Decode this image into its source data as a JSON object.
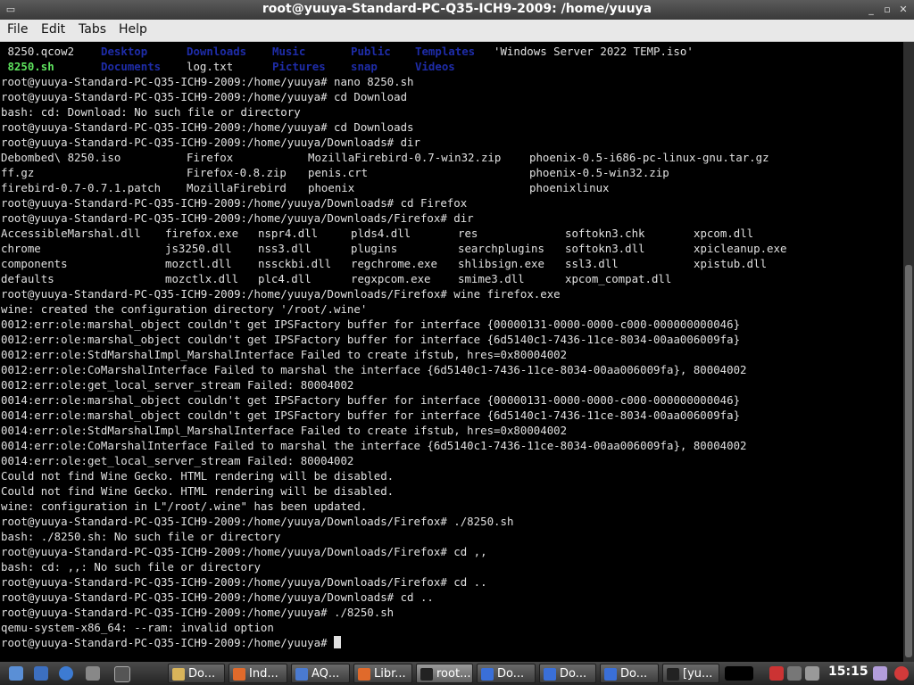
{
  "window": {
    "title": "root@yuuya-Standard-PC-Q35-ICH9-2009: /home/yuuya"
  },
  "menu": [
    "File",
    "Edit",
    "Tabs",
    "Help"
  ],
  "colors": {
    "dir": "#1e2ca8",
    "exe": "#5ee35e",
    "text": "#e0e0e0"
  },
  "terminal": {
    "lines": [
      [
        {
          "t": " 8250.qcow2",
          "c": 0
        },
        {
          "t": "Desktop",
          "c": 112,
          "k": "dir"
        },
        {
          "t": "Downloads",
          "c": 208,
          "k": "dir"
        },
        {
          "t": "Music",
          "c": 304,
          "k": "dir"
        },
        {
          "t": "Public",
          "c": 392,
          "k": "dir"
        },
        {
          "t": "Templates",
          "c": 464,
          "k": "dir"
        },
        {
          "t": "'Windows Server 2022 TEMP.iso'",
          "c": 552
        }
      ],
      [
        {
          "t": " 8250.sh",
          "c": 0,
          "k": "exe"
        },
        {
          "t": "Documents",
          "c": 112,
          "k": "dir"
        },
        {
          "t": "log.txt",
          "c": 208
        },
        {
          "t": "Pictures",
          "c": 304,
          "k": "dir"
        },
        {
          "t": "snap",
          "c": 392,
          "k": "dir"
        },
        {
          "t": "Videos",
          "c": 464,
          "k": "dir"
        }
      ],
      "root@yuuya-Standard-PC-Q35-ICH9-2009:/home/yuuya# nano 8250.sh",
      "root@yuuya-Standard-PC-Q35-ICH9-2009:/home/yuuya# cd Download",
      "bash: cd: Download: No such file or directory",
      "root@yuuya-Standard-PC-Q35-ICH9-2009:/home/yuuya# cd Downloads",
      "root@yuuya-Standard-PC-Q35-ICH9-2009:/home/yuuya/Downloads# dir",
      [
        {
          "t": "Debombed\\ 8250.iso",
          "c": 0
        },
        {
          "t": "Firefox",
          "c": 208
        },
        {
          "t": "MozillaFirebird-0.7-win32.zip",
          "c": 344
        },
        {
          "t": "phoenix-0.5-i686-pc-linux-gnu.tar.gz",
          "c": 592
        }
      ],
      [
        {
          "t": "ff.gz",
          "c": 0
        },
        {
          "t": "Firefox-0.8.zip",
          "c": 208
        },
        {
          "t": "penis.crt",
          "c": 344
        },
        {
          "t": "phoenix-0.5-win32.zip",
          "c": 592
        }
      ],
      [
        {
          "t": "firebird-0.7-0.7.1.patch",
          "c": 0
        },
        {
          "t": "MozillaFirebird",
          "c": 208
        },
        {
          "t": "phoenix",
          "c": 344
        },
        {
          "t": "phoenixlinux",
          "c": 592
        }
      ],
      "root@yuuya-Standard-PC-Q35-ICH9-2009:/home/yuuya/Downloads# cd Firefox",
      "root@yuuya-Standard-PC-Q35-ICH9-2009:/home/yuuya/Downloads/Firefox# dir",
      [
        {
          "t": "AccessibleMarshal.dll",
          "c": 0
        },
        {
          "t": "firefox.exe",
          "c": 184
        },
        {
          "t": "nspr4.dll",
          "c": 288
        },
        {
          "t": "plds4.dll",
          "c": 392
        },
        {
          "t": "res",
          "c": 512
        },
        {
          "t": "softokn3.chk",
          "c": 632
        },
        {
          "t": "xpcom.dll",
          "c": 776
        }
      ],
      [
        {
          "t": "chrome",
          "c": 0
        },
        {
          "t": "js3250.dll",
          "c": 184
        },
        {
          "t": "nss3.dll",
          "c": 288
        },
        {
          "t": "plugins",
          "c": 392
        },
        {
          "t": "searchplugins",
          "c": 512
        },
        {
          "t": "softokn3.dll",
          "c": 632
        },
        {
          "t": "xpicleanup.exe",
          "c": 776
        }
      ],
      [
        {
          "t": "components",
          "c": 0
        },
        {
          "t": "mozctl.dll",
          "c": 184
        },
        {
          "t": "nssckbi.dll",
          "c": 288
        },
        {
          "t": "regchrome.exe",
          "c": 392
        },
        {
          "t": "shlibsign.exe",
          "c": 512
        },
        {
          "t": "ssl3.dll",
          "c": 632
        },
        {
          "t": "xpistub.dll",
          "c": 776
        }
      ],
      [
        {
          "t": "defaults",
          "c": 0
        },
        {
          "t": "mozctlx.dll",
          "c": 184
        },
        {
          "t": "plc4.dll",
          "c": 288
        },
        {
          "t": "regxpcom.exe",
          "c": 392
        },
        {
          "t": "smime3.dll",
          "c": 512
        },
        {
          "t": "xpcom_compat.dll",
          "c": 632
        }
      ],
      "root@yuuya-Standard-PC-Q35-ICH9-2009:/home/yuuya/Downloads/Firefox# wine firefox.exe",
      "wine: created the configuration directory '/root/.wine'",
      "0012:err:ole:marshal_object couldn't get IPSFactory buffer for interface {00000131-0000-0000-c000-000000000046}",
      "0012:err:ole:marshal_object couldn't get IPSFactory buffer for interface {6d5140c1-7436-11ce-8034-00aa006009fa}",
      "0012:err:ole:StdMarshalImpl_MarshalInterface Failed to create ifstub, hres=0x80004002",
      "0012:err:ole:CoMarshalInterface Failed to marshal the interface {6d5140c1-7436-11ce-8034-00aa006009fa}, 80004002",
      "0012:err:ole:get_local_server_stream Failed: 80004002",
      "0014:err:ole:marshal_object couldn't get IPSFactory buffer for interface {00000131-0000-0000-c000-000000000046}",
      "0014:err:ole:marshal_object couldn't get IPSFactory buffer for interface {6d5140c1-7436-11ce-8034-00aa006009fa}",
      "0014:err:ole:StdMarshalImpl_MarshalInterface Failed to create ifstub, hres=0x80004002",
      "0014:err:ole:CoMarshalInterface Failed to marshal the interface {6d5140c1-7436-11ce-8034-00aa006009fa}, 80004002",
      "0014:err:ole:get_local_server_stream Failed: 80004002",
      "Could not find Wine Gecko. HTML rendering will be disabled.",
      "Could not find Wine Gecko. HTML rendering will be disabled.",
      "wine: configuration in L\"/root/.wine\" has been updated.",
      "root@yuuya-Standard-PC-Q35-ICH9-2009:/home/yuuya/Downloads/Firefox# ./8250.sh",
      "bash: ./8250.sh: No such file or directory",
      "root@yuuya-Standard-PC-Q35-ICH9-2009:/home/yuuya/Downloads/Firefox# cd ,,",
      "bash: cd: ,,: No such file or directory",
      "root@yuuya-Standard-PC-Q35-ICH9-2009:/home/yuuya/Downloads/Firefox# cd ..",
      "root@yuuya-Standard-PC-Q35-ICH9-2009:/home/yuuya/Downloads# cd ..",
      "root@yuuya-Standard-PC-Q35-ICH9-2009:/home/yuuya# ./8250.sh",
      "qemu-system-x86_64: --ram: invalid option",
      "root@yuuya-Standard-PC-Q35-ICH9-2009:/home/yuuya# "
    ]
  },
  "taskbar": {
    "buttons": [
      {
        "label": "Do...",
        "icon": "folder-icon",
        "color": "#d9b45a"
      },
      {
        "label": "Ind...",
        "icon": "firefox-icon",
        "color": "#e06a2b"
      },
      {
        "label": "AQ...",
        "icon": "browser-icon",
        "color": "#4a7ad0"
      },
      {
        "label": "Libr...",
        "icon": "firefox-icon",
        "color": "#e06a2b"
      },
      {
        "label": "root...",
        "icon": "terminal-icon",
        "color": "#222222",
        "active": true
      },
      {
        "label": "Do...",
        "icon": "document-icon",
        "color": "#3a6fd8"
      },
      {
        "label": "Do...",
        "icon": "document-icon",
        "color": "#3a6fd8"
      },
      {
        "label": "Do...",
        "icon": "document-icon",
        "color": "#3a6fd8"
      },
      {
        "label": "[yu...",
        "icon": "terminal-icon",
        "color": "#222222"
      }
    ],
    "clock": "15:15"
  }
}
